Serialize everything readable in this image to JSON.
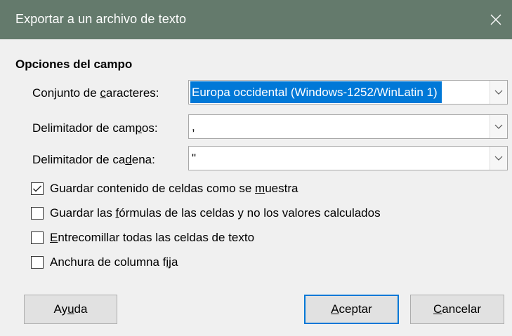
{
  "window": {
    "title": "Exportar a un archivo de texto",
    "close_icon": "close-icon"
  },
  "section": {
    "title": "Opciones del campo"
  },
  "fields": {
    "charset": {
      "label_pre": "Conjunto de ",
      "label_mnemonic": "c",
      "label_post": "aracteres:",
      "value": "Europa occidental (Windows-1252/WinLatin 1)"
    },
    "field_delimiter": {
      "label_pre": "Delimitador de cam",
      "label_mnemonic": "p",
      "label_post": "os:",
      "value": ","
    },
    "string_delimiter": {
      "label_pre": "Delimitador de ca",
      "label_mnemonic": "d",
      "label_post": "ena:",
      "value": "\""
    }
  },
  "options": [
    {
      "pre": "Guardar contenido de celdas como se ",
      "mnemonic": "m",
      "post": "uestra",
      "checked": true
    },
    {
      "pre": "Guardar las ",
      "mnemonic": "f",
      "post": "órmulas de las celdas y no los valores calculados",
      "checked": false
    },
    {
      "pre": "",
      "mnemonic": "E",
      "post": "ntrecomillar todas las celdas de texto",
      "checked": false
    },
    {
      "pre": "Anchura de columna f",
      "mnemonic": "i",
      "post": "ja",
      "checked": false
    }
  ],
  "buttons": {
    "help": {
      "pre": "Ay",
      "mnemonic": "u",
      "post": "da"
    },
    "ok": {
      "pre": "",
      "mnemonic": "A",
      "post": "ceptar"
    },
    "cancel": {
      "pre": "",
      "mnemonic": "C",
      "post": "ancelar"
    }
  },
  "colors": {
    "titlebar": "#647a6c",
    "selection": "#0078d7",
    "default_button_border": "#0078d7"
  }
}
